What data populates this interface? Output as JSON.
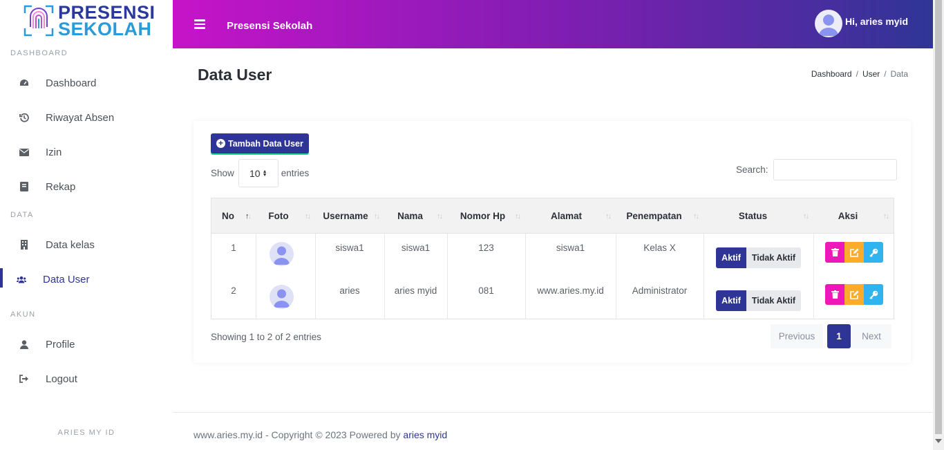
{
  "brand": {
    "line1": "PRESENSI",
    "line2": "SEKOLAH",
    "colors": {
      "primary": "#2f3596",
      "accent": "#2b9bd8",
      "gradient_start": "#c613c9",
      "gradient_end": "#2f3596"
    }
  },
  "sidebar": {
    "sections": [
      {
        "title": "DASHBOARD",
        "items": [
          {
            "label": "Dashboard",
            "icon": "tachometer-icon"
          },
          {
            "label": "Riwayat Absen",
            "icon": "history-icon"
          },
          {
            "label": "Izin",
            "icon": "envelope-icon"
          },
          {
            "label": "Rekap",
            "icon": "book-icon"
          }
        ]
      },
      {
        "title": "DATA",
        "items": [
          {
            "label": "Data kelas",
            "icon": "building-icon"
          },
          {
            "label": "Data User",
            "icon": "users-icon",
            "active": true
          }
        ]
      },
      {
        "title": "AKUN",
        "items": [
          {
            "label": "Profile",
            "icon": "user-icon"
          },
          {
            "label": "Logout",
            "icon": "sign-out-icon"
          }
        ]
      }
    ],
    "footer": "ARIES MY ID"
  },
  "topbar": {
    "title": "Presensi Sekolah",
    "user_greeting": "Hi, aries myid"
  },
  "page": {
    "title": "Data User",
    "breadcrumb": [
      "Dashboard",
      "User",
      "Data"
    ],
    "breadcrumb_sep": "/"
  },
  "toolbar": {
    "add_label": "Tambah Data User",
    "show_label": "Show",
    "entries_label": "entries",
    "page_length": "10",
    "search_label": "Search:"
  },
  "table": {
    "columns": [
      "No",
      "Foto",
      "Username",
      "Nama",
      "Nomor Hp",
      "Alamat",
      "Penempatan",
      "Status",
      "Aksi"
    ],
    "rows": [
      {
        "no": "1",
        "username": "siswa1",
        "nama": "siswa1",
        "hp": "123",
        "alamat": "siswa1",
        "penempatan": "Kelas X",
        "status_on": "Aktif",
        "status_off": "Tidak Aktif"
      },
      {
        "no": "2",
        "username": "aries",
        "nama": "aries myid",
        "hp": "081",
        "alamat": "www.aries.my.id",
        "penempatan": "Administrator",
        "status_on": "Aktif",
        "status_off": "Tidak Aktif"
      }
    ],
    "info": "Showing 1 to 2 of 2 entries"
  },
  "pagination": {
    "previous": "Previous",
    "current": "1",
    "next": "Next"
  },
  "footer": {
    "prefix": "www.aries.my.id - Copyright © 2023 Powered by",
    "link": "aries myid"
  }
}
